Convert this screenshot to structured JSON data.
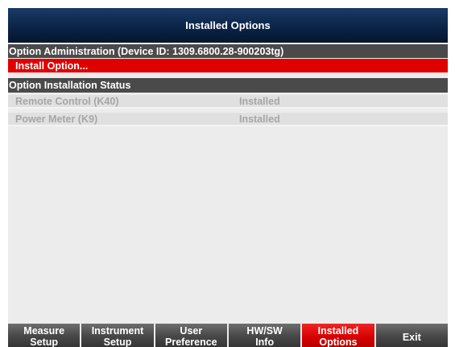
{
  "window": {
    "title": "Installed Options"
  },
  "admin": {
    "header": "Option Administration (Device ID: 1309.6800.28-900203tg)",
    "install_label": "Install Option..."
  },
  "status": {
    "header": "Option Installation Status",
    "options": [
      {
        "name": "Remote Control (K40)",
        "status": "Installed"
      },
      {
        "name": "Power Meter (K9)",
        "status": "Installed"
      }
    ]
  },
  "softkeys": [
    {
      "line1": "Measure",
      "line2": "Setup"
    },
    {
      "line1": "Instrument",
      "line2": "Setup"
    },
    {
      "line1": "User",
      "line2": "Preference"
    },
    {
      "line1": "HW/SW",
      "line2": "Info"
    },
    {
      "line1": "Installed",
      "line2": "Options",
      "active": true
    },
    {
      "line1": "Exit",
      "line2": ""
    }
  ],
  "colors": {
    "title_bg": "#0b2447",
    "highlight": "#e00000",
    "section_header_bg": "#4a4a4a",
    "disabled_text": "#a6a6a6"
  }
}
